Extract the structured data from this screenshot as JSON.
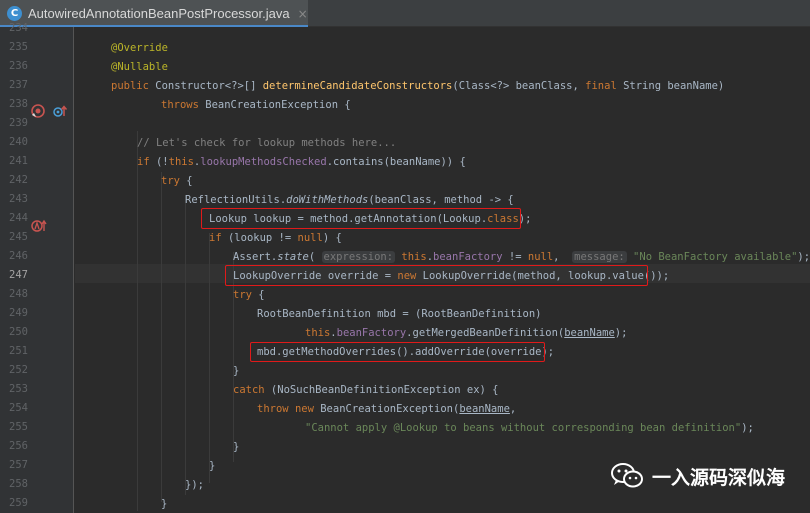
{
  "tab": {
    "icon_letter": "C",
    "title": "AutowiredAnnotationBeanPostProcessor.java",
    "close": "×"
  },
  "line_numbers": [
    "234",
    "235",
    "236",
    "237",
    "238",
    "239",
    "240",
    "241",
    "242",
    "243",
    "244",
    "245",
    "246",
    "247",
    "248",
    "249",
    "250",
    "251",
    "252",
    "253",
    "254",
    "255",
    "256",
    "257",
    "258",
    "259"
  ],
  "current_line": "247",
  "code": {
    "l235": {
      "a1": "@Override"
    },
    "l236": {
      "a1": "@Nullable"
    },
    "l237": {
      "k1": "public",
      "t1": " Constructor<?>[] ",
      "f1": "determineCandidateConstructors",
      "t2": "(Class<?> beanClass, ",
      "k2": "final",
      "t3": " String beanName)"
    },
    "l238": {
      "k1": "throws",
      "t1": " BeanCreationException {"
    },
    "l240": {
      "c1": "// Let's check for lookup methods here..."
    },
    "l241": {
      "k1": "if",
      "t1": " (!",
      "k2": "this",
      "t2": ".",
      "p1": "lookupMethodsChecked",
      "t3": ".contains(beanName)) {"
    },
    "l242": {
      "k1": "try",
      "t1": " {"
    },
    "l243": {
      "t1": "ReflectionUtils.",
      "i1": "doWithMethods",
      "t2": "(beanClass, method -> {"
    },
    "l244": {
      "t1": "Lookup lookup = method.getAnnotation(Lookup.",
      "k1": "class",
      "t2": ");"
    },
    "l245": {
      "k1": "if",
      "t1": " (lookup != ",
      "k2": "null",
      "t2": ") {"
    },
    "l246": {
      "t1": "Assert.",
      "i1": "state",
      "t2": "( ",
      "h1": "expression:",
      "t3": " ",
      "k1": "this",
      "t4": ".",
      "p1": "beanFactory",
      "t5": " != ",
      "k2": "null",
      "t6": ",  ",
      "h2": "message:",
      "t7": " ",
      "s1": "\"No BeanFactory available\"",
      "t8": ");"
    },
    "l247": {
      "t1": "LookupOverride override = ",
      "k1": "new",
      "t2": " LookupOverride(method, lookup.value());"
    },
    "l248": {
      "k1": "try",
      "t1": " {"
    },
    "l249": {
      "t1": "RootBeanDefinition mbd = (RootBeanDefinition)"
    },
    "l250": {
      "k1": "this",
      "t1": ".",
      "p1": "beanFactory",
      "t2": ".getMergedBeanDefinition(",
      "u1": "beanName",
      "t3": ");"
    },
    "l251": {
      "t1": "mbd.getMethodOverrides().addOverride(override);"
    },
    "l252": {
      "t1": "}"
    },
    "l253": {
      "k1": "catch",
      "t1": " (NoSuchBeanDefinitionException ex) {"
    },
    "l254": {
      "k1": "throw",
      "t1": " ",
      "k2": "new",
      "t2": " BeanCreationException(",
      "u1": "beanName",
      "t3": ","
    },
    "l255": {
      "s1": "\"Cannot apply @Lookup to beans without corresponding bean definition\"",
      "t1": ");"
    },
    "l256": {
      "t1": "}"
    },
    "l257": {
      "t1": "}"
    },
    "l258": {
      "t1": "});"
    },
    "l259": {
      "t1": "}"
    }
  },
  "watermark": {
    "text": "一入源码深似海"
  },
  "colors": {
    "keyword": "#cc7832",
    "annotation": "#bbb529",
    "method": "#ffc66d",
    "field": "#9876aa",
    "string": "#6a8759",
    "comment": "#808080",
    "highlight_box": "#e01a1a",
    "tab_underline": "#4a88c7"
  }
}
